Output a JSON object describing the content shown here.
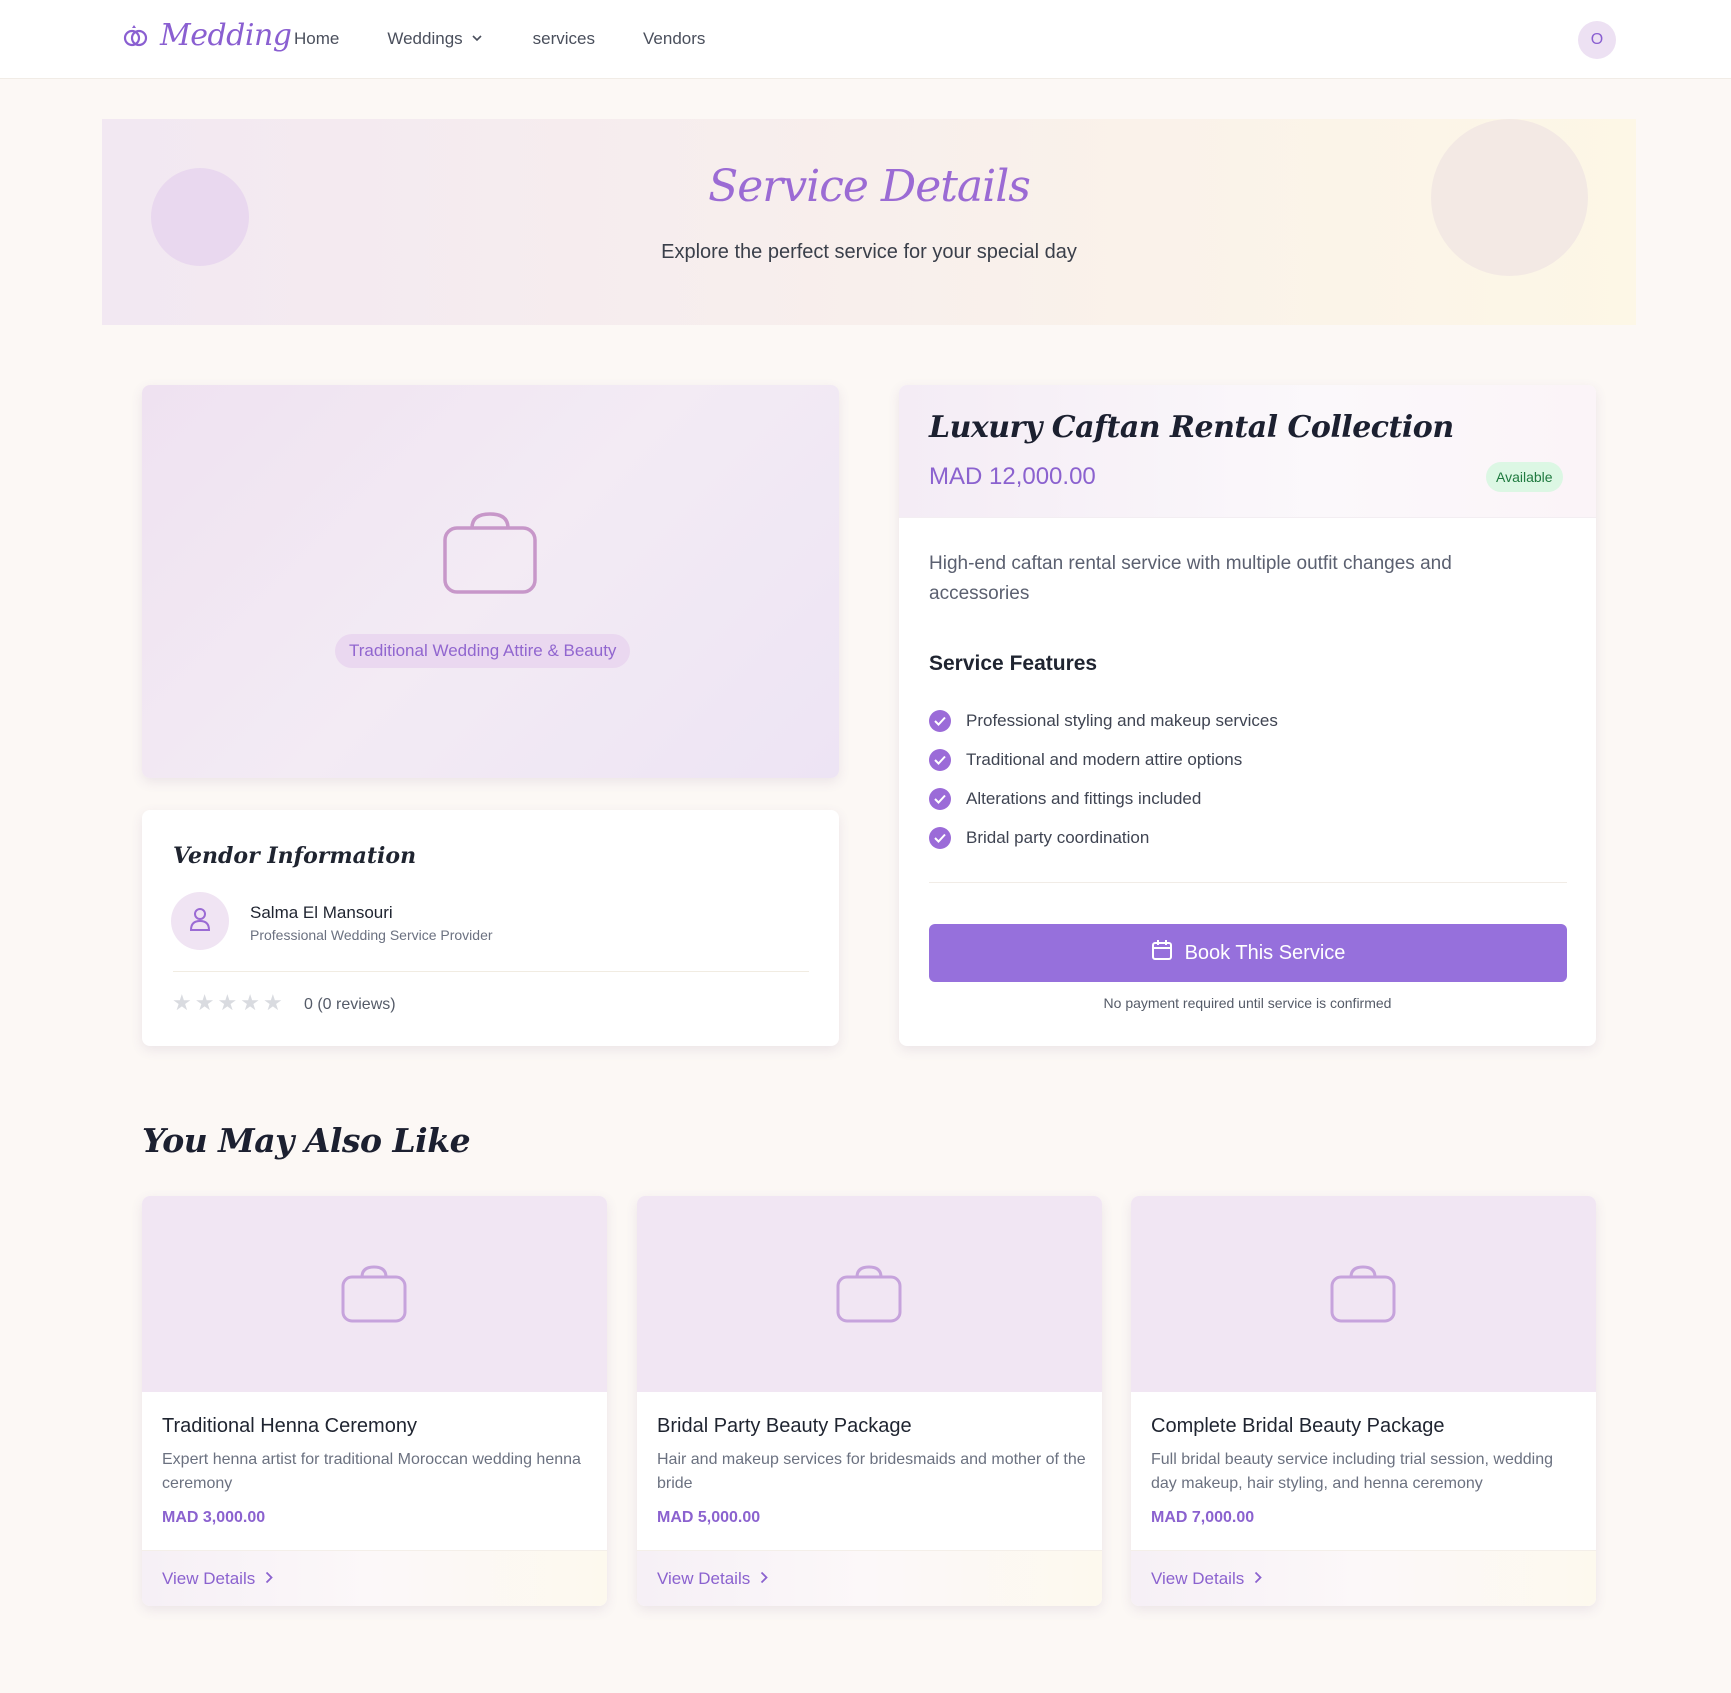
{
  "nav": {
    "brand": "Medding",
    "links": [
      "Home",
      "Weddings",
      "services",
      "Vendors"
    ],
    "avatar_initial": "O"
  },
  "hero": {
    "title": "Service Details",
    "subtitle": "Explore the perfect service for your special day"
  },
  "image_card": {
    "category": "Traditional Wedding Attire & Beauty"
  },
  "vendor": {
    "heading": "Vendor Information",
    "name": "Salma El Mansouri",
    "role": "Professional Wedding Service Provider",
    "rating_stars": 0,
    "reviews_text": "0 (0 reviews)"
  },
  "service": {
    "title": "Luxury Caftan Rental Collection",
    "price": "MAD 12,000.00",
    "status": "Available",
    "description": "High-end caftan rental service with multiple outfit changes and accessories",
    "features_heading": "Service Features",
    "features": [
      "Professional styling and makeup services",
      "Traditional and modern attire options",
      "Alterations and fittings included",
      "Bridal party coordination"
    ],
    "book_label": "Book This Service",
    "book_note": "No payment required until service is confirmed"
  },
  "related": {
    "heading": "You May Also Like",
    "view_label": "View Details",
    "items": [
      {
        "title": "Traditional Henna Ceremony",
        "description": "Expert henna artist for traditional Moroccan wedding henna ceremony",
        "price": "MAD 3,000.00"
      },
      {
        "title": "Bridal Party Beauty Package",
        "description": "Hair and makeup services for bridesmaids and mother of the bride",
        "price": "MAD 5,000.00"
      },
      {
        "title": "Complete Bridal Beauty Package",
        "description": "Full bridal beauty service including trial session, wedding day makeup, hair styling, and henna ceremony",
        "price": "MAD 7,000.00"
      }
    ]
  },
  "colors": {
    "accent": "#9670dc",
    "accent_text": "#8b62cf",
    "page_bg": "#fcf8f5",
    "status_green": "#1f7a3f"
  },
  "icons": [
    "rings-icon",
    "chevron-down-icon",
    "bag-icon",
    "user-icon",
    "star-icon",
    "check-icon",
    "calendar-icon",
    "chevron-right-icon"
  ]
}
